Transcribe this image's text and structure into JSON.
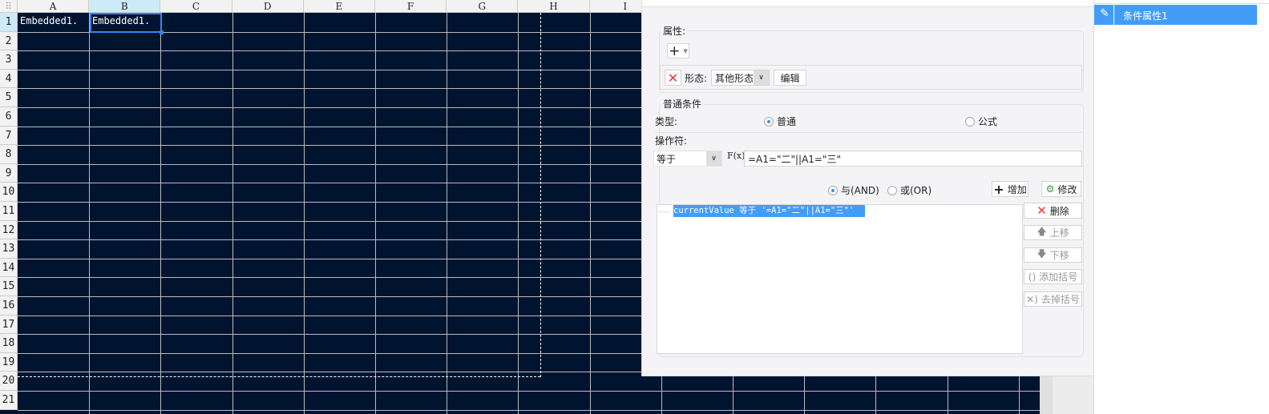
{
  "sheet": {
    "columns": [
      "A",
      "B",
      "C",
      "D",
      "E",
      "F",
      "G",
      "H",
      "I"
    ],
    "rows": [
      "1",
      "2",
      "3",
      "4",
      "5",
      "6",
      "7",
      "8",
      "9",
      "10",
      "11",
      "12",
      "13",
      "14",
      "15",
      "16",
      "17",
      "18",
      "19",
      "20",
      "21"
    ],
    "cells": {
      "A1": "Embedded1.",
      "B1": "Embedded1."
    },
    "selected_cell": "B1",
    "background": "#001430"
  },
  "dialog": {
    "attributes_group": "属性:",
    "add_button": "+",
    "form_label": "形态:",
    "form_value": "其他形态",
    "edit_button": "编辑",
    "normal_condition_group": "普通条件",
    "type_label": "类型:",
    "type_options": [
      "普通",
      "公式"
    ],
    "type_selected": "普通",
    "operator_label": "操作符:",
    "operator_value": "等于",
    "fx_label": "F(x)",
    "formula_value": "=A1=\"二\"||A1=\"三\"",
    "logic_options": [
      "与(AND)",
      "或(OR)"
    ],
    "logic_selected": "与(AND)",
    "add_cond_button": "增加",
    "modify_button": "修改",
    "conditions": [
      "currentValue 等于 '=A1=\"二\"||A1=\"三\"'"
    ],
    "side_buttons": {
      "delete": "删除",
      "move_up": "上移",
      "move_down": "下移",
      "add_paren": "添加括号",
      "remove_paren": "去掉括号"
    }
  },
  "side_panel": {
    "items": [
      {
        "label": "条件属性1",
        "selected": true
      }
    ],
    "accent": "#439df8"
  }
}
